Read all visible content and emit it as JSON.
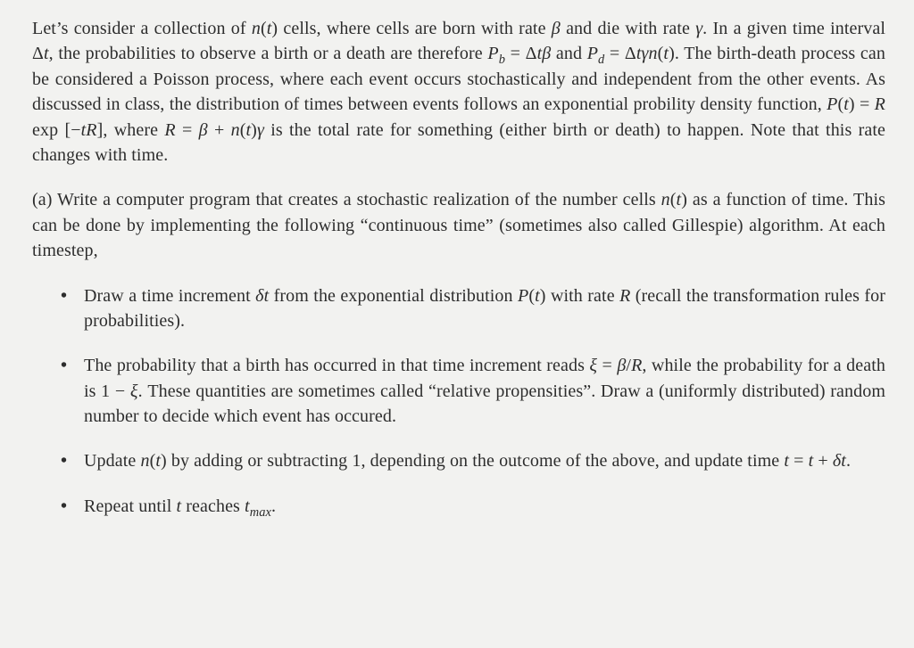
{
  "intro": {
    "p1_a": "Let’s consider a collection of ",
    "nt": "n",
    "t_in_paren": "t",
    "p1_b": " cells, where cells are born with rate ",
    "beta": "β",
    "p1_c": " and die with rate ",
    "gamma": "γ",
    "p1_d": ". In a given time interval Δ",
    "t_var": "t",
    "p1_e": ", the probabilities to observe a birth or a death are therefore ",
    "Pb": "P",
    "b_sub": "b",
    "eq": " = Δ",
    "p1_f": " and ",
    "Pd": "P",
    "d_sub": "d",
    "p1_g": ". The birth-death process can be considered a Poisson process, where each event occurs stochastically and independent from the other events. As discussed in class, the distribution of times between events follows an exponential probility density function, ",
    "Pt": "P",
    "p1_h": " = ",
    "R": "R",
    "exp_open": " exp [−",
    "exp_close": "], where ",
    "p1_i": " = ",
    "plus": " + ",
    "p1_j": " is the total rate for something (either birth or death) to happen. Note that this rate changes with time."
  },
  "partA": {
    "label": "(a) ",
    "text_a": "Write a computer program that creates a stochastic realization of the number cells ",
    "text_b": " as a function of time. This can be done by implementing the following “continuous time” (sometimes also called Gillespie) algorithm. At each timestep,"
  },
  "bullets": {
    "b1_a": "Draw a time increment ",
    "delta": "δt",
    "b1_b": " from the exponential distribution ",
    "b1_c": " with rate ",
    "b1_d": " (recall the transformation rules for probabilities).",
    "b2_a": "The probability that a birth has occurred in that time increment reads ",
    "xi": "ξ",
    "b2_b": " = ",
    "slash": "/",
    "b2_c": ", while the probability for a death is 1 − ",
    "b2_d": ". These quantities are sometimes called “relative propensities”. Draw a (uniformly distributed) random number to decide which event has occured.",
    "b3_a": "Update ",
    "b3_b": " by adding or subtracting 1, depending on the outcome of the above, and update time ",
    "b3_c": " = ",
    "b3_d": " + ",
    "b3_e": ".",
    "b4_a": "Repeat until ",
    "b4_b": " reaches ",
    "tmax_sub": "max",
    "b4_c": "."
  }
}
